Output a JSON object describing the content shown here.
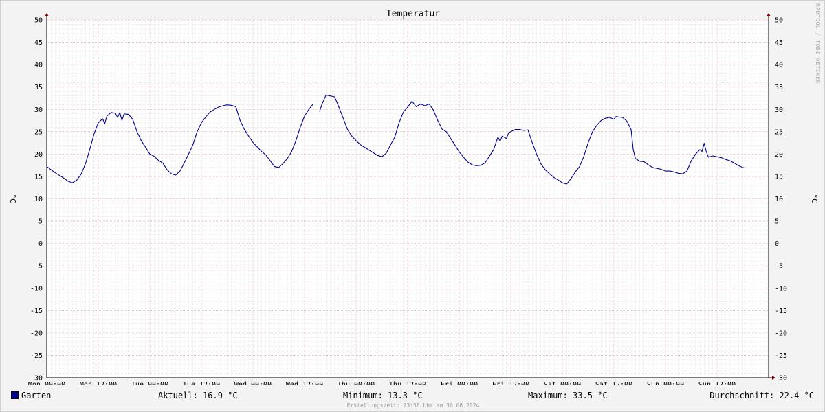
{
  "chart_data": {
    "type": "line",
    "title": "Temperatur",
    "ylabel": "°C",
    "ylabel_right": "°C",
    "ylim": [
      -30,
      50
    ],
    "yticks": [
      50,
      45,
      40,
      35,
      30,
      25,
      20,
      15,
      10,
      5,
      0,
      -5,
      -10,
      -15,
      -20,
      -25,
      -30
    ],
    "xlim": [
      0,
      168
    ],
    "xtick_labels": [
      "Mon 00:00",
      "Mon 12:00",
      "Tue 00:00",
      "Tue 12:00",
      "Wed 00:00",
      "Wed 12:00",
      "Thu 00:00",
      "Thu 12:00",
      "Fri 00:00",
      "Fri 12:00",
      "Sat 00:00",
      "Sat 12:00",
      "Sun 00:00",
      "Sun 12:00"
    ],
    "grid": true,
    "legend_position": "bottom-left",
    "series": [
      {
        "name": "Garten",
        "color": "#00008b",
        "segments": [
          [
            [
              0,
              17.2
            ],
            [
              1,
              16.5
            ],
            [
              2,
              15.8
            ],
            [
              3,
              15.2
            ],
            [
              4,
              14.6
            ],
            [
              5,
              13.9
            ],
            [
              6,
              13.6
            ],
            [
              7,
              14.2
            ],
            [
              8,
              15.5
            ],
            [
              9,
              17.8
            ],
            [
              10,
              21
            ],
            [
              11,
              24.5
            ],
            [
              12,
              27
            ],
            [
              13,
              27.9
            ],
            [
              13.5,
              26.8
            ],
            [
              14,
              28.5
            ],
            [
              15,
              29.3
            ],
            [
              16,
              29.1
            ],
            [
              16.5,
              28.2
            ],
            [
              17,
              29.3
            ],
            [
              17.5,
              27.5
            ],
            [
              18,
              29
            ],
            [
              19,
              28.9
            ],
            [
              20,
              27.8
            ],
            [
              21,
              25
            ],
            [
              22,
              23
            ],
            [
              23,
              21.5
            ],
            [
              24,
              20
            ],
            [
              25,
              19.5
            ],
            [
              26,
              18.6
            ],
            [
              27,
              18
            ],
            [
              28,
              16.5
            ],
            [
              29,
              15.6
            ],
            [
              30,
              15.3
            ],
            [
              31,
              16.2
            ],
            [
              32,
              18
            ],
            [
              33,
              20
            ],
            [
              34,
              22
            ],
            [
              35,
              25
            ],
            [
              36,
              27
            ],
            [
              37,
              28.3
            ],
            [
              38,
              29.4
            ],
            [
              39,
              30
            ],
            [
              40,
              30.5
            ],
            [
              41,
              30.8
            ],
            [
              42,
              31
            ],
            [
              43,
              30.9
            ],
            [
              44,
              30.6
            ],
            [
              45,
              27.5
            ],
            [
              46,
              25.5
            ],
            [
              47,
              24
            ],
            [
              48,
              22.6
            ],
            [
              49,
              21.6
            ],
            [
              50,
              20.6
            ],
            [
              51,
              19.8
            ],
            [
              52,
              18.5
            ],
            [
              53,
              17.2
            ],
            [
              54,
              17
            ],
            [
              55,
              17.9
            ],
            [
              56,
              19
            ],
            [
              57,
              20.6
            ],
            [
              58,
              23
            ],
            [
              59,
              26
            ],
            [
              60,
              28.5
            ],
            [
              61,
              30
            ],
            [
              62,
              31.2
            ]
          ],
          [
            [
              63.5,
              29.5
            ],
            [
              64,
              31
            ],
            [
              65,
              33.2
            ],
            [
              66,
              33
            ],
            [
              67,
              32.8
            ],
            [
              68,
              30.5
            ],
            [
              69,
              28
            ],
            [
              70,
              25.5
            ],
            [
              71,
              24
            ],
            [
              72,
              23
            ],
            [
              73,
              22.1
            ],
            [
              74,
              21.5
            ],
            [
              75,
              20.9
            ],
            [
              76,
              20.3
            ],
            [
              77,
              19.7
            ],
            [
              78,
              19.4
            ],
            [
              79,
              20.2
            ],
            [
              80,
              22
            ],
            [
              81,
              23.8
            ],
            [
              82,
              27
            ],
            [
              83,
              29.4
            ],
            [
              84,
              30.5
            ],
            [
              85,
              31.8
            ],
            [
              86,
              30.6
            ],
            [
              87,
              31.2
            ],
            [
              88,
              30.8
            ],
            [
              89,
              31.2
            ],
            [
              90,
              29.8
            ],
            [
              91,
              27.5
            ],
            [
              92,
              25.6
            ],
            [
              93,
              25
            ],
            [
              94,
              23.5
            ],
            [
              95,
              22
            ],
            [
              96,
              20.5
            ],
            [
              97,
              19.3
            ],
            [
              98,
              18.2
            ],
            [
              99,
              17.6
            ],
            [
              100,
              17.4
            ],
            [
              101,
              17.5
            ],
            [
              102,
              18
            ],
            [
              103,
              19.5
            ],
            [
              104,
              21
            ],
            [
              105,
              23.8
            ],
            [
              105.5,
              22.9
            ],
            [
              106,
              24
            ],
            [
              107,
              23.5
            ],
            [
              107.5,
              24.8
            ],
            [
              108,
              25
            ],
            [
              109,
              25.5
            ],
            [
              110,
              25.5
            ],
            [
              111,
              25.3
            ],
            [
              112,
              25.4
            ],
            [
              113,
              22.5
            ],
            [
              114,
              20
            ],
            [
              115,
              17.8
            ],
            [
              116,
              16.5
            ],
            [
              117,
              15.6
            ],
            [
              118,
              14.8
            ],
            [
              119,
              14.2
            ],
            [
              120,
              13.6
            ],
            [
              121,
              13.3
            ],
            [
              122,
              14.5
            ],
            [
              123,
              16
            ],
            [
              124,
              17.2
            ],
            [
              125,
              19.5
            ],
            [
              126,
              22.5
            ],
            [
              127,
              25
            ],
            [
              128,
              26.4
            ],
            [
              129,
              27.5
            ],
            [
              130,
              28
            ],
            [
              131,
              28.2
            ],
            [
              132,
              27.8
            ],
            [
              132.5,
              28.4
            ],
            [
              133,
              28.3
            ],
            [
              134,
              28.2
            ],
            [
              135,
              27.4
            ],
            [
              136,
              25.5
            ],
            [
              136.5,
              21
            ],
            [
              137,
              19
            ],
            [
              138,
              18.4
            ],
            [
              139,
              18.3
            ],
            [
              140,
              17.6
            ],
            [
              141,
              17
            ],
            [
              142,
              16.8
            ],
            [
              143,
              16.6
            ],
            [
              144,
              16.2
            ],
            [
              145,
              16.2
            ],
            [
              146,
              16
            ],
            [
              147,
              15.7
            ],
            [
              148,
              15.6
            ],
            [
              149,
              16.2
            ],
            [
              150,
              18.5
            ],
            [
              151,
              20
            ],
            [
              152,
              21
            ],
            [
              152.5,
              20.6
            ],
            [
              153,
              22.4
            ],
            [
              153.5,
              20.5
            ],
            [
              154,
              19.3
            ],
            [
              155,
              19.6
            ],
            [
              156,
              19.4
            ],
            [
              157,
              19.2
            ],
            [
              158,
              18.8
            ],
            [
              159,
              18.5
            ],
            [
              160,
              18
            ],
            [
              161,
              17.4
            ],
            [
              162,
              17.0
            ],
            [
              162.5,
              16.9
            ]
          ]
        ]
      }
    ],
    "stats": {
      "current": "Aktuell: 16.9 °C",
      "minimum": "Minimum: 13.3 °C",
      "maximum": "Maximum: 33.5 °C",
      "average": "Durchschnitt: 22.4 °C"
    },
    "footer": "Erstellungszeit: 23:58 Uhr am 30.06.2024",
    "watermark": "RRDTOOL / TOBI OETIKER"
  }
}
